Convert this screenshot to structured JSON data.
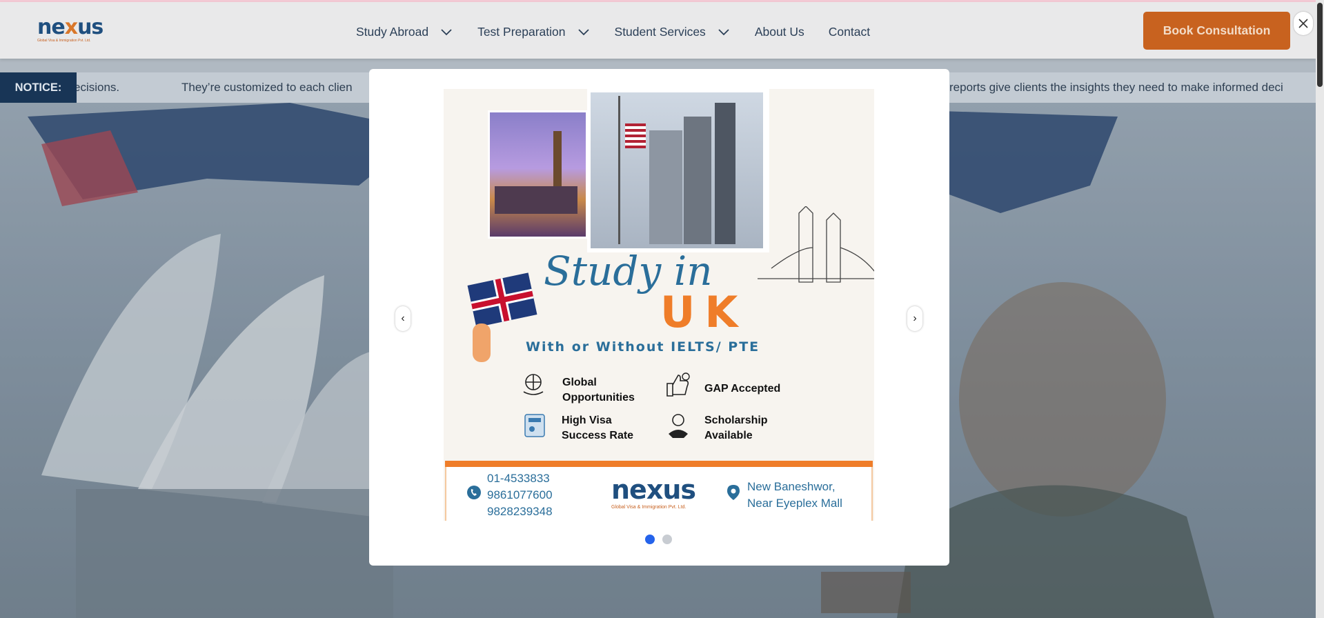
{
  "brand": {
    "logo_text_1": "ne",
    "logo_text_x": "x",
    "logo_text_2": "us",
    "logo_sub": "Global Visa & Immigration Pvt. Ltd."
  },
  "nav": {
    "items": [
      {
        "label": "Study Abroad",
        "has_dropdown": true
      },
      {
        "label": "Test Preparation",
        "has_dropdown": true
      },
      {
        "label": "Student Services",
        "has_dropdown": true
      },
      {
        "label": "About Us",
        "has_dropdown": false
      },
      {
        "label": "Contact",
        "has_dropdown": false
      }
    ],
    "cta_label": "Book Consultation"
  },
  "notice": {
    "label": "NOTICE:",
    "text_1": "ecisions.",
    "text_2": "They’re customized to each clien",
    "text_3": "reports give clients the insights they need to make informed deci"
  },
  "modal": {
    "prev_label": "‹",
    "next_label": "›",
    "slides_total": 2,
    "active_slide": 1,
    "poster": {
      "script_title": "Study in",
      "country": "UK",
      "subtitle": "With or Without IELTS/ PTE",
      "features": [
        {
          "icon": "globe-hands-icon",
          "line1": "Global",
          "line2": "Opportunities"
        },
        {
          "icon": "thumbs-up-icon",
          "line1": "GAP Accepted",
          "line2": ""
        },
        {
          "icon": "visa-card-icon",
          "line1": "High Visa",
          "line2": "Success Rate"
        },
        {
          "icon": "scholarship-icon",
          "line1": "Scholarship",
          "line2": "Available"
        }
      ],
      "phones": [
        "01-4533833",
        "9861077600",
        "9828239348"
      ],
      "footer_logo": "nexus",
      "footer_logo_sub": "Global Visa & Immigration Pvt. Ltd.",
      "address_line1": "New Baneshwor,",
      "address_line2": "Near Eyeplex Mall"
    }
  },
  "colors": {
    "brand_blue": "#1f4f7f",
    "brand_orange": "#d9772a",
    "cta": "#c8621f",
    "notice_label_bg": "#183556",
    "dot_active": "#2563eb",
    "dot_inactive": "#c8ccd2"
  }
}
